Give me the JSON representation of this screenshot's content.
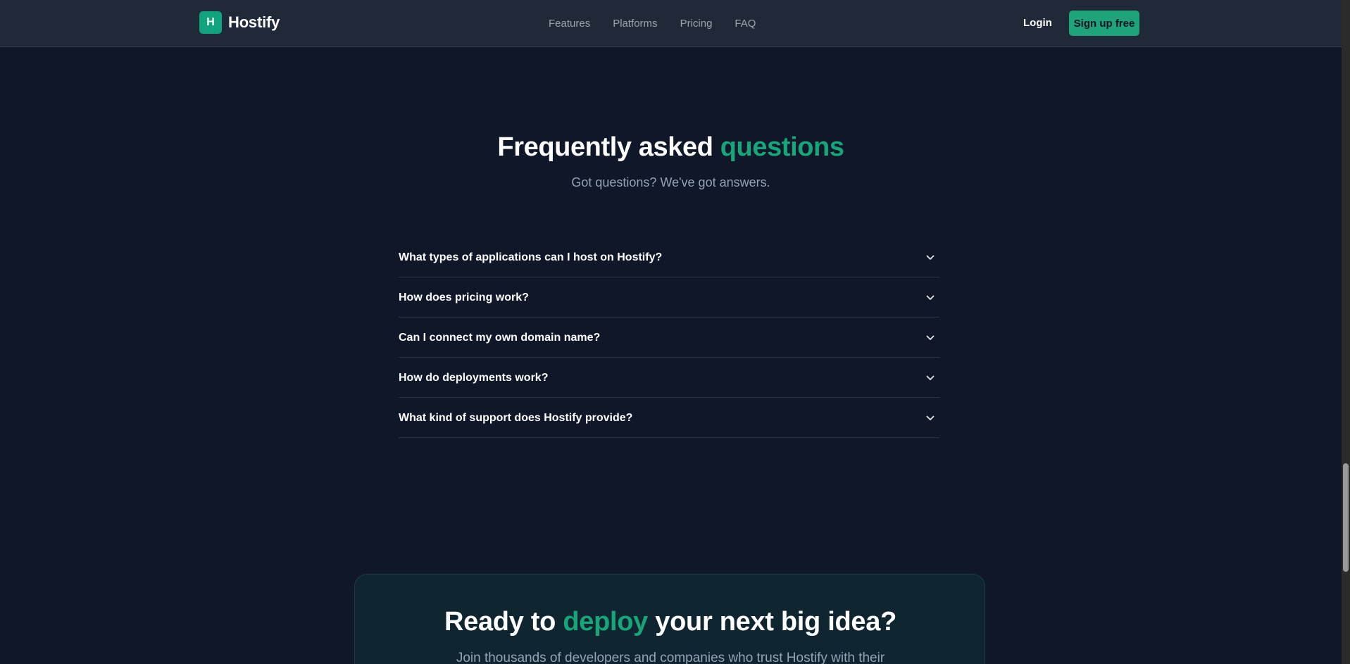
{
  "header": {
    "brand_mark": "H",
    "brand_name": "Hostify",
    "nav": [
      "Features",
      "Platforms",
      "Pricing",
      "FAQ"
    ],
    "login_label": "Login",
    "signup_label": "Sign up free"
  },
  "faq": {
    "title_prefix": "Frequently asked",
    "title_accent": "questions",
    "subtitle": "Got questions? We've got answers.",
    "items": [
      "What types of applications can I host on Hostify?",
      "How does pricing work?",
      "Can I connect my own domain name?",
      "How do deployments work?",
      "What kind of support does Hostify provide?"
    ]
  },
  "cta": {
    "title_prefix": "Ready to",
    "title_accent": "deploy",
    "title_suffix": "your next big idea?",
    "subtitle": "Join thousands of developers and companies who trust Hostify with their"
  },
  "colors": {
    "background": "#0f1729",
    "header": "#1f2937",
    "accent": "#17a57a",
    "brand_mark": "#10a37f"
  },
  "icons": {
    "faq_toggle": "chevron-down-icon"
  }
}
